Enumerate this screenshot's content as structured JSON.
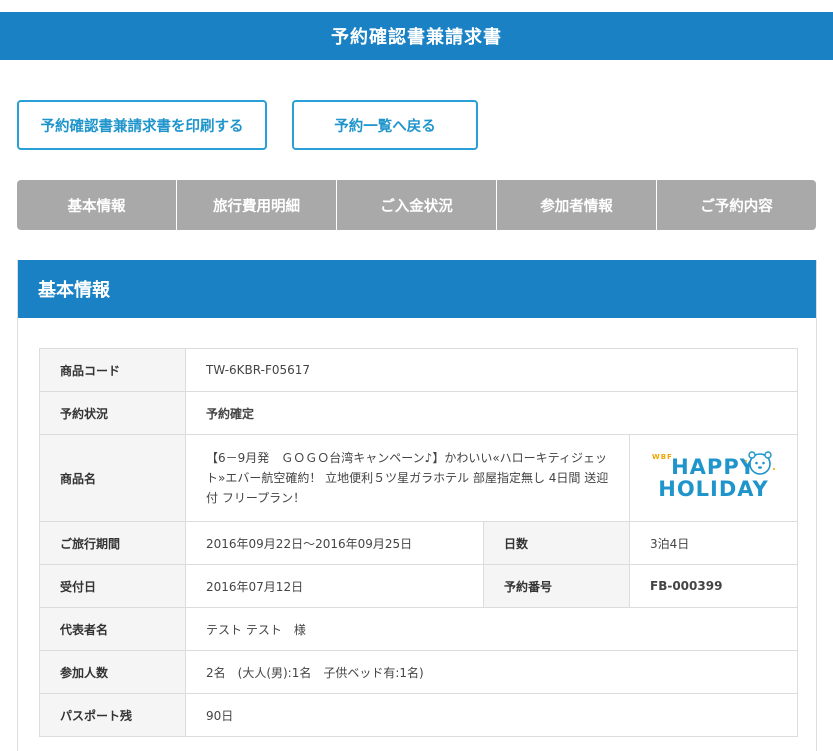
{
  "header": {
    "title": "予約確認書兼請求書"
  },
  "actions": {
    "print_label": "予約確認書兼請求書を印刷する",
    "back_label": "予約一覧へ戻る"
  },
  "tabs": [
    {
      "label": "基本情報"
    },
    {
      "label": "旅行費用明細"
    },
    {
      "label": "ご入金状況"
    },
    {
      "label": "参加者情報"
    },
    {
      "label": "ご予約内容"
    }
  ],
  "section": {
    "title": "基本情報",
    "product_code": {
      "label": "商品コード",
      "value": "TW-6KBR-F05617"
    },
    "status": {
      "label": "予約状況",
      "value": "予約確定"
    },
    "product_name": {
      "label": "商品名",
      "value": "【6－9月発　ＧＯＧＯ台湾キャンペーン♪】かわいい«ハローキティジェット»エバー航空確約！ 立地便利５ツ星ガラホテル 部屋指定無し 4日間 送迎付 フリープラン！"
    },
    "logo": {
      "small": "WBF",
      "line1": "HAPPY",
      "line2": "HOLIDAY"
    },
    "period": {
      "label": "ご旅行期間",
      "value": "2016年09月22日～2016年09月25日"
    },
    "days": {
      "label": "日数",
      "value": "3泊4日"
    },
    "received": {
      "label": "受付日",
      "value": "2016年07月12日"
    },
    "booking_no": {
      "label": "予約番号",
      "value": "FB-000399"
    },
    "representative": {
      "label": "代表者名",
      "value": "テスト テスト　様"
    },
    "participants": {
      "label": "参加人数",
      "value": "2名　(大人(男):1名　子供ベッド有:1名)"
    },
    "passport": {
      "label": "パスポート残",
      "value": "90日"
    }
  },
  "colors": {
    "primary": "#1a82c4",
    "accent_red": "#c8002f",
    "tab_gray": "#a9a9a9"
  }
}
